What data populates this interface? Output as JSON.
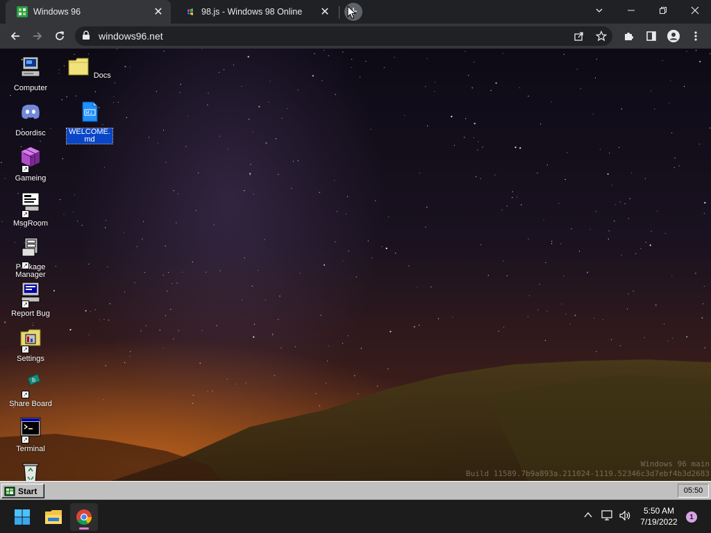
{
  "browser": {
    "tabs": [
      {
        "title": "Windows 96",
        "active": true
      },
      {
        "title": "98.js - Windows 98 Online",
        "active": false
      }
    ],
    "url": "windows96.net"
  },
  "desktop": {
    "icons": [
      {
        "label": "Computer",
        "icon": "computer-icon"
      },
      {
        "label": "Doordisc",
        "icon": "discord-icon"
      },
      {
        "label": "Gameing",
        "icon": "game-cube-icon"
      },
      {
        "label": "MsgRoom",
        "icon": "chat-icon"
      },
      {
        "label": "Package Manager",
        "icon": "package-icon"
      },
      {
        "label": "Report Bug",
        "icon": "report-bug-icon"
      },
      {
        "label": "Settings",
        "icon": "settings-folder-icon"
      },
      {
        "label": "Share Board",
        "icon": "share-board-icon"
      },
      {
        "label": "Terminal",
        "icon": "terminal-icon"
      },
      {
        "label": "Docs",
        "icon": "folder-icon"
      },
      {
        "label": "WELCOME.md",
        "icon": "markdown-file-icon",
        "selected": true
      }
    ],
    "watermark": {
      "line1": "Windows 96 main",
      "line2": "Build 11589.7b9a893a.211024-1119.52346c3d7ebf4b3d2683"
    }
  },
  "win96_taskbar": {
    "start_label": "Start",
    "clock": "05:50"
  },
  "windows_taskbar": {
    "time": "5:50 AM",
    "date": "7/19/2022",
    "notification_count": "1"
  },
  "colors": {
    "chrome_tabstrip": "#202124",
    "chrome_toolbar": "#35363a",
    "win96_gray": "#c0c0c0",
    "selection": "#0a46c8",
    "w11_taskbar": "#1c1c1c"
  }
}
